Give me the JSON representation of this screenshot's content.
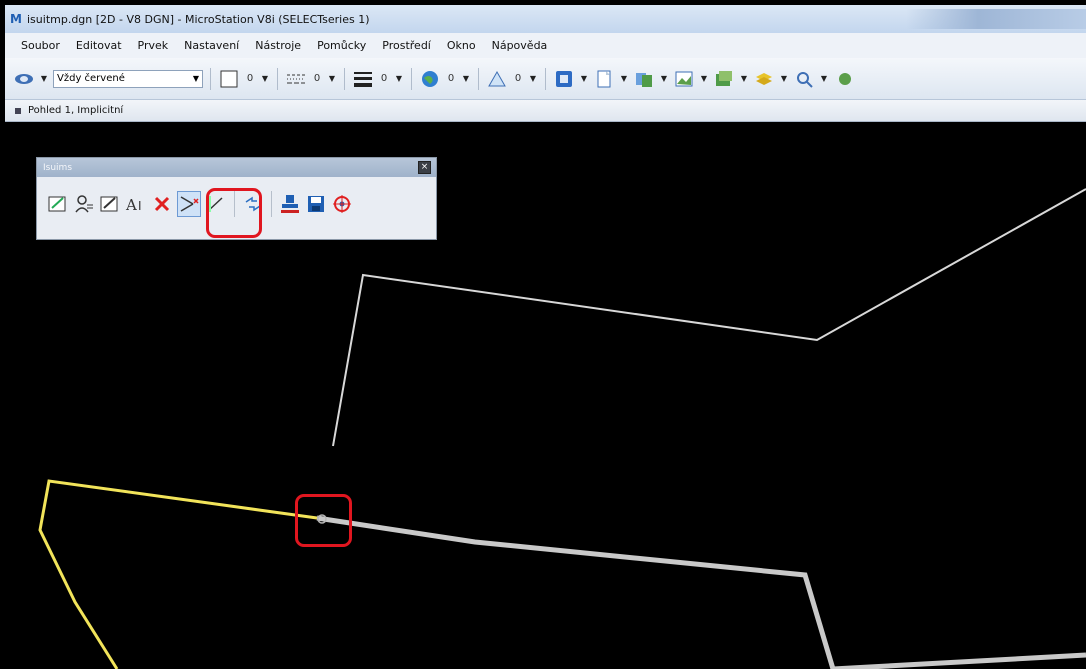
{
  "window": {
    "title": "isuitmp.dgn [2D - V8 DGN] - MicroStation V8i (SELECTseries 1)"
  },
  "menu": {
    "items": [
      "Soubor",
      "Editovat",
      "Prvek",
      "Nastavení",
      "Nástroje",
      "Pomůcky",
      "Prostředí",
      "Okno",
      "Nápověda"
    ]
  },
  "toolbar": {
    "level_select": "Vždy červené",
    "color_value": "0",
    "style_value": "0",
    "weight_value": "0",
    "transparency_value": "0",
    "priority_value": "0"
  },
  "view": {
    "title": "Pohled 1, Implicitní"
  },
  "palette": {
    "title": "Isuims",
    "tools": [
      "edit-attributes",
      "user",
      "edit-geometry",
      "text",
      "delete",
      "split-line",
      "merge",
      "swap",
      "stamp",
      "save",
      "locate"
    ]
  },
  "colors": {
    "canvas_bg": "#000000",
    "white_line": "#d8d8d8",
    "yellow_line": "#f2e45a",
    "highlight": "#e0161f"
  }
}
